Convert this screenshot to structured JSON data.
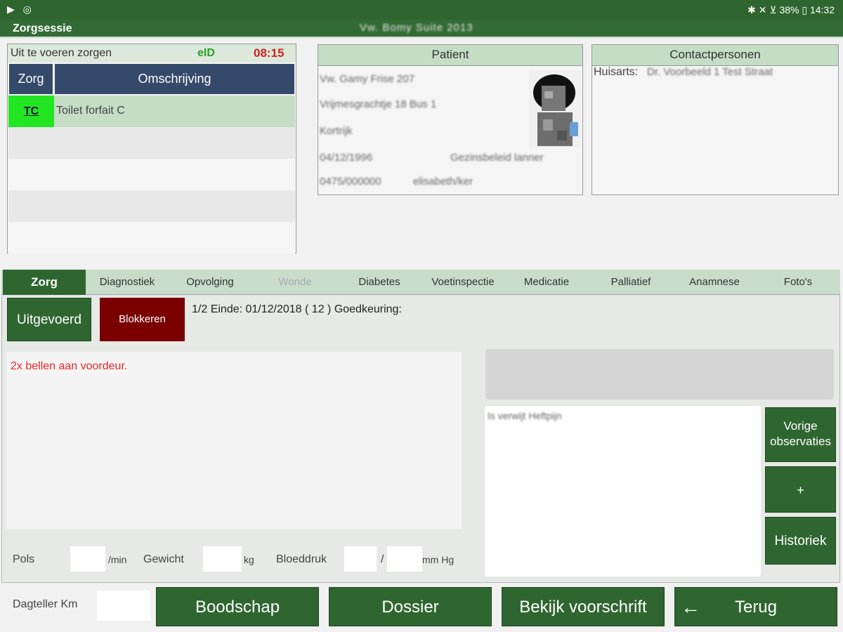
{
  "statusbar": {
    "left_icons": "▶ ◎",
    "right_text": "✱ ✕ ⊻ 38% ▯ 14:32",
    "battery": "38%",
    "time": "14:32"
  },
  "titlebar": {
    "title": "Zorgsessie",
    "session_text": "Vw. Bomy Suite 2013"
  },
  "care_list": {
    "header": "Uit te voeren zorgen",
    "eid": "eID",
    "time": "08:15",
    "columns": [
      "Zorg",
      "Omschrijving"
    ],
    "rows": [
      {
        "code": "TC",
        "description": "Toilet forfait C"
      }
    ]
  },
  "patient": {
    "header": "Patient",
    "lines": [
      "Vw. Gamy Frise 207",
      "Vrijmesgrachtje 18 Bus 1",
      "Kortrijk",
      "04/12/1996",
      "Gezinsbeleid lanner",
      "0475/000000",
      "elisabeth/ker"
    ]
  },
  "contacts": {
    "header": "Contactpersonen",
    "label": "Huisarts:",
    "value": "Dr. Voorbeeld 1 Test Straat"
  },
  "tabs": [
    "Zorg",
    "Diagnostiek",
    "Opvolging",
    "Wonde",
    "Diabetes",
    "Voetinspectie",
    "Medicatie",
    "Palliatief",
    "Anamnese",
    "Foto's"
  ],
  "zorg_tab": {
    "uitgevoerd_label": "Uitgevoerd",
    "blokkeren_label": "Blokkeren",
    "info": "1/2 Einde: 01/12/2018 ( 12 ) Goedkeuring:",
    "note": "2x bellen aan voordeur.",
    "observation_text": "Is verwijt Heftpijn",
    "vorige_label": "Vorige observaties",
    "plus_label": "+",
    "historiek_label": "Historiek",
    "vitals": {
      "pols_label": "Pols",
      "pols_unit": "/min",
      "gewicht_label": "Gewicht",
      "gewicht_unit": "kg",
      "bloeddruk_label": "Bloeddruk",
      "bloeddruk_sep": "/",
      "bloeddruk_unit": "mm Hg"
    }
  },
  "bottom": {
    "dagteller_label": "Dagteller Km",
    "boodschap": "Boodschap",
    "dossier": "Dossier",
    "voorschrift": "Bekijk voorschrift",
    "terug": "Terug"
  },
  "colors": {
    "primary_green": "#2f6630",
    "header_navy": "#354a6b",
    "block_red": "#7a0000",
    "code_green": "#22e622",
    "note_red": "#e8262a"
  }
}
